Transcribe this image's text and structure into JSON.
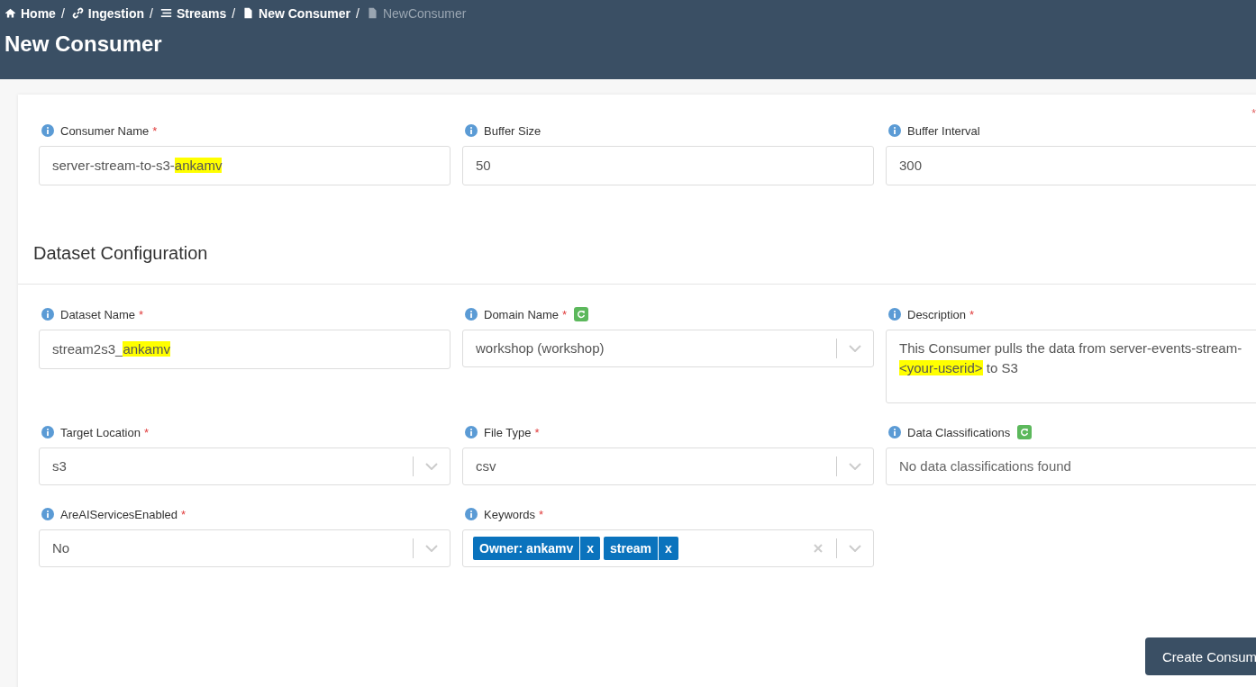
{
  "breadcrumbs": [
    {
      "label": "Home",
      "separator": "/",
      "current": false
    },
    {
      "label": "Ingestion",
      "separator": "/",
      "current": false
    },
    {
      "label": "Streams",
      "separator": "/",
      "current": false
    },
    {
      "label": "New Consumer",
      "separator": "/",
      "current": false
    },
    {
      "label": "NewConsumer",
      "current": true
    }
  ],
  "page_title": "New Consumer",
  "required_note": "*",
  "top_fields": [
    {
      "label": "Consumer Name",
      "required": true,
      "refresh": false,
      "value": [
        {
          "text": "server-stream-to-s3-",
          "highlight": false
        },
        {
          "text": "ankamv",
          "highlight": true
        }
      ]
    },
    {
      "label": "Buffer Size",
      "required": false,
      "refresh": false,
      "value": [
        {
          "text": "50",
          "highlight": false
        }
      ]
    },
    {
      "label": "Buffer Interval",
      "required": false,
      "refresh": false,
      "value": [
        {
          "text": "300",
          "highlight": false
        }
      ]
    }
  ],
  "section_title": "Dataset Configuration",
  "fields": [
    {
      "label": "Dataset Name",
      "required": true,
      "refresh": false,
      "kind": "text",
      "value": [
        {
          "text": "stream2s3_",
          "highlight": false
        },
        {
          "text": "ankamv",
          "highlight": true
        }
      ]
    },
    {
      "label": "Domain Name",
      "required": true,
      "refresh": true,
      "kind": "select",
      "value": [
        {
          "text": "workshop (workshop)",
          "highlight": false
        }
      ]
    },
    {
      "label": "Description",
      "required": true,
      "refresh": false,
      "kind": "textarea",
      "value": [
        {
          "text": "This Consumer pulls the data from server-events-stream-",
          "highlight": false
        },
        {
          "text": "<your-userid>",
          "highlight": true
        },
        {
          "text": " to S3",
          "highlight": false
        }
      ]
    },
    {
      "label": "Target Location",
      "required": true,
      "refresh": false,
      "kind": "select",
      "value": [
        {
          "text": "s3",
          "highlight": false
        }
      ]
    },
    {
      "label": "File Type",
      "required": true,
      "refresh": false,
      "kind": "select",
      "value": [
        {
          "text": "csv",
          "highlight": false
        }
      ]
    },
    {
      "label": "Data Classifications",
      "required": false,
      "refresh": true,
      "kind": "placeholder",
      "placeholder": "No data classifications found"
    },
    {
      "label": "AreAIServicesEnabled",
      "required": true,
      "refresh": false,
      "kind": "select",
      "value": [
        {
          "text": "No",
          "highlight": false
        }
      ]
    },
    {
      "label": "Keywords",
      "required": true,
      "refresh": false,
      "kind": "tags",
      "tags": [
        {
          "label": "Owner: ankamv",
          "remove": "x"
        },
        {
          "label": "stream",
          "remove": "x"
        }
      ]
    }
  ],
  "submit_button": "Create Consum"
}
